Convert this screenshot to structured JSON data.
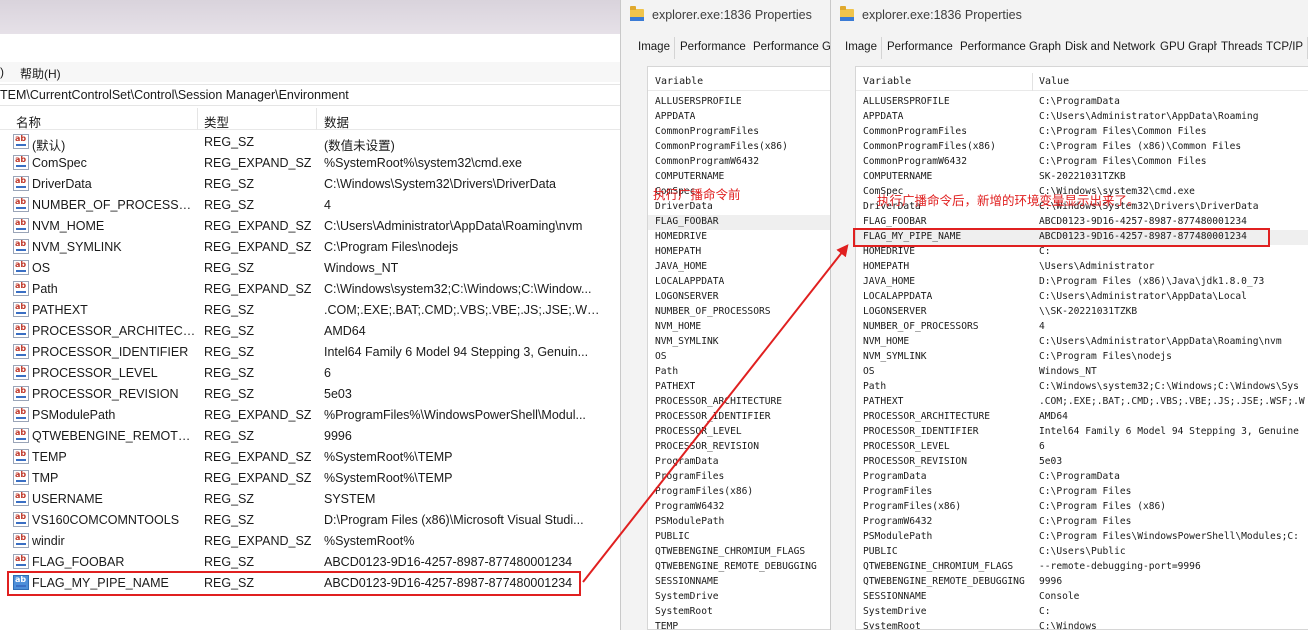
{
  "regedit": {
    "menu": [
      ")",
      "帮助(H)"
    ],
    "address": "TEM\\CurrentControlSet\\Control\\Session Manager\\Environment",
    "columns": {
      "name": "名称",
      "type": "类型",
      "data": "数据"
    },
    "rows": [
      {
        "name": "(默认)",
        "type": "REG_SZ",
        "data": "(数值未设置)"
      },
      {
        "name": "ComSpec",
        "type": "REG_EXPAND_SZ",
        "data": "%SystemRoot%\\system32\\cmd.exe"
      },
      {
        "name": "DriverData",
        "type": "REG_SZ",
        "data": "C:\\Windows\\System32\\Drivers\\DriverData"
      },
      {
        "name": "NUMBER_OF_PROCESSORS",
        "type": "REG_SZ",
        "data": "4"
      },
      {
        "name": "NVM_HOME",
        "type": "REG_EXPAND_SZ",
        "data": "C:\\Users\\Administrator\\AppData\\Roaming\\nvm"
      },
      {
        "name": "NVM_SYMLINK",
        "type": "REG_EXPAND_SZ",
        "data": "C:\\Program Files\\nodejs"
      },
      {
        "name": "OS",
        "type": "REG_SZ",
        "data": "Windows_NT"
      },
      {
        "name": "Path",
        "type": "REG_EXPAND_SZ",
        "data": "C:\\Windows\\system32;C:\\Windows;C:\\Window..."
      },
      {
        "name": "PATHEXT",
        "type": "REG_SZ",
        "data": ".COM;.EXE;.BAT;.CMD;.VBS;.VBE;.JS;.JSE;.WSF;..."
      },
      {
        "name": "PROCESSOR_ARCHITECTU...",
        "type": "REG_SZ",
        "data": "AMD64"
      },
      {
        "name": "PROCESSOR_IDENTIFIER",
        "type": "REG_SZ",
        "data": "Intel64 Family 6 Model 94 Stepping 3, Genuin..."
      },
      {
        "name": "PROCESSOR_LEVEL",
        "type": "REG_SZ",
        "data": "6"
      },
      {
        "name": "PROCESSOR_REVISION",
        "type": "REG_SZ",
        "data": "5e03"
      },
      {
        "name": "PSModulePath",
        "type": "REG_EXPAND_SZ",
        "data": "%ProgramFiles%\\WindowsPowerShell\\Modul..."
      },
      {
        "name": "QTWEBENGINE_REMOTE_...",
        "type": "REG_SZ",
        "data": "9996"
      },
      {
        "name": "TEMP",
        "type": "REG_EXPAND_SZ",
        "data": "%SystemRoot%\\TEMP"
      },
      {
        "name": "TMP",
        "type": "REG_EXPAND_SZ",
        "data": "%SystemRoot%\\TEMP"
      },
      {
        "name": "USERNAME",
        "type": "REG_SZ",
        "data": "SYSTEM"
      },
      {
        "name": "VS160COMCOMNTOOLS",
        "type": "REG_SZ",
        "data": "D:\\Program Files (x86)\\Microsoft Visual Studi..."
      },
      {
        "name": "windir",
        "type": "REG_EXPAND_SZ",
        "data": "%SystemRoot%"
      },
      {
        "name": "FLAG_FOOBAR",
        "type": "REG_SZ",
        "data": "ABCD0123-9D16-4257-8987-877480001234"
      },
      {
        "name": "FLAG_MY_PIPE_NAME",
        "type": "REG_SZ",
        "data": "ABCD0123-9D16-4257-8987-877480001234"
      }
    ]
  },
  "pe_left": {
    "title": "explorer.exe:1836 Properties",
    "tabs": [
      "Image",
      "Performance",
      "Performance Gr"
    ],
    "column": "Variable",
    "variables": [
      "ALLUSERSPROFILE",
      "APPDATA",
      "CommonProgramFiles",
      "CommonProgramFiles(x86)",
      "CommonProgramW6432",
      "COMPUTERNAME",
      "ComSpec",
      "DriverData",
      "FLAG_FOOBAR",
      "HOMEDRIVE",
      "HOMEPATH",
      "JAVA_HOME",
      "LOCALAPPDATA",
      "LOGONSERVER",
      "NUMBER_OF_PROCESSORS",
      "NVM_HOME",
      "NVM_SYMLINK",
      "OS",
      "Path",
      "PATHEXT",
      "PROCESSOR_ARCHITECTURE",
      "PROCESSOR_IDENTIFIER",
      "PROCESSOR_LEVEL",
      "PROCESSOR_REVISION",
      "ProgramData",
      "ProgramFiles",
      "ProgramFiles(x86)",
      "ProgramW6432",
      "PSModulePath",
      "PUBLIC",
      "QTWEBENGINE_CHROMIUM_FLAGS",
      "QTWEBENGINE_REMOTE_DEBUGGING",
      "SESSIONNAME",
      "SystemDrive",
      "SystemRoot",
      "TEMP"
    ],
    "annotation": "执行广播命令前"
  },
  "pe_right": {
    "title": "explorer.exe:1836 Properties",
    "tabs": [
      "Image",
      "Performance",
      "Performance Graph",
      "Disk and Network",
      "GPU Graph",
      "Threads",
      "TCP/IP"
    ],
    "columns": {
      "variable": "Variable",
      "value": "Value"
    },
    "rows": [
      {
        "v": "ALLUSERSPROFILE",
        "val": "C:\\ProgramData"
      },
      {
        "v": "APPDATA",
        "val": "C:\\Users\\Administrator\\AppData\\Roaming"
      },
      {
        "v": "CommonProgramFiles",
        "val": "C:\\Program Files\\Common Files"
      },
      {
        "v": "CommonProgramFiles(x86)",
        "val": "C:\\Program Files (x86)\\Common Files"
      },
      {
        "v": "CommonProgramW6432",
        "val": "C:\\Program Files\\Common Files"
      },
      {
        "v": "COMPUTERNAME",
        "val": "SK-20221031TZKB"
      },
      {
        "v": "ComSpec",
        "val": "C:\\Windows\\system32\\cmd.exe"
      },
      {
        "v": "DriverData",
        "val": "C:\\Windows\\System32\\Drivers\\DriverData"
      },
      {
        "v": "FLAG_FOOBAR",
        "val": "ABCD0123-9D16-4257-8987-877480001234"
      },
      {
        "v": "FLAG_MY_PIPE_NAME",
        "val": "ABCD0123-9D16-4257-8987-877480001234"
      },
      {
        "v": "HOMEDRIVE",
        "val": "C:"
      },
      {
        "v": "HOMEPATH",
        "val": "\\Users\\Administrator"
      },
      {
        "v": "JAVA_HOME",
        "val": "D:\\Program Files (x86)\\Java\\jdk1.8.0_73"
      },
      {
        "v": "LOCALAPPDATA",
        "val": "C:\\Users\\Administrator\\AppData\\Local"
      },
      {
        "v": "LOGONSERVER",
        "val": "\\\\SK-20221031TZKB"
      },
      {
        "v": "NUMBER_OF_PROCESSORS",
        "val": "4"
      },
      {
        "v": "NVM_HOME",
        "val": "C:\\Users\\Administrator\\AppData\\Roaming\\nvm"
      },
      {
        "v": "NVM_SYMLINK",
        "val": "C:\\Program Files\\nodejs"
      },
      {
        "v": "OS",
        "val": "Windows_NT"
      },
      {
        "v": "Path",
        "val": "C:\\Windows\\system32;C:\\Windows;C:\\Windows\\Sys"
      },
      {
        "v": "PATHEXT",
        "val": ".COM;.EXE;.BAT;.CMD;.VBS;.VBE;.JS;.JSE;.WSF;.W"
      },
      {
        "v": "PROCESSOR_ARCHITECTURE",
        "val": "AMD64"
      },
      {
        "v": "PROCESSOR_IDENTIFIER",
        "val": "Intel64 Family 6 Model 94 Stepping 3, Genuine"
      },
      {
        "v": "PROCESSOR_LEVEL",
        "val": "6"
      },
      {
        "v": "PROCESSOR_REVISION",
        "val": "5e03"
      },
      {
        "v": "ProgramData",
        "val": "C:\\ProgramData"
      },
      {
        "v": "ProgramFiles",
        "val": "C:\\Program Files"
      },
      {
        "v": "ProgramFiles(x86)",
        "val": "C:\\Program Files (x86)"
      },
      {
        "v": "ProgramW6432",
        "val": "C:\\Program Files"
      },
      {
        "v": "PSModulePath",
        "val": "C:\\Program Files\\WindowsPowerShell\\Modules;C:"
      },
      {
        "v": "PUBLIC",
        "val": "C:\\Users\\Public"
      },
      {
        "v": "QTWEBENGINE_CHROMIUM_FLAGS",
        "val": "--remote-debugging-port=9996"
      },
      {
        "v": "QTWEBENGINE_REMOTE_DEBUGGING",
        "val": "9996"
      },
      {
        "v": "SESSIONNAME",
        "val": "Console"
      },
      {
        "v": "SystemDrive",
        "val": "C:"
      },
      {
        "v": "SystemRoot",
        "val": "C:\\Windows"
      }
    ],
    "annotation": "执行广播命令后，新增的环境变量显示出来了。"
  },
  "colors": {
    "annotation": "#e02020",
    "folder": "#f0c44c",
    "registry_icon_blue": "#4d8fd9"
  }
}
